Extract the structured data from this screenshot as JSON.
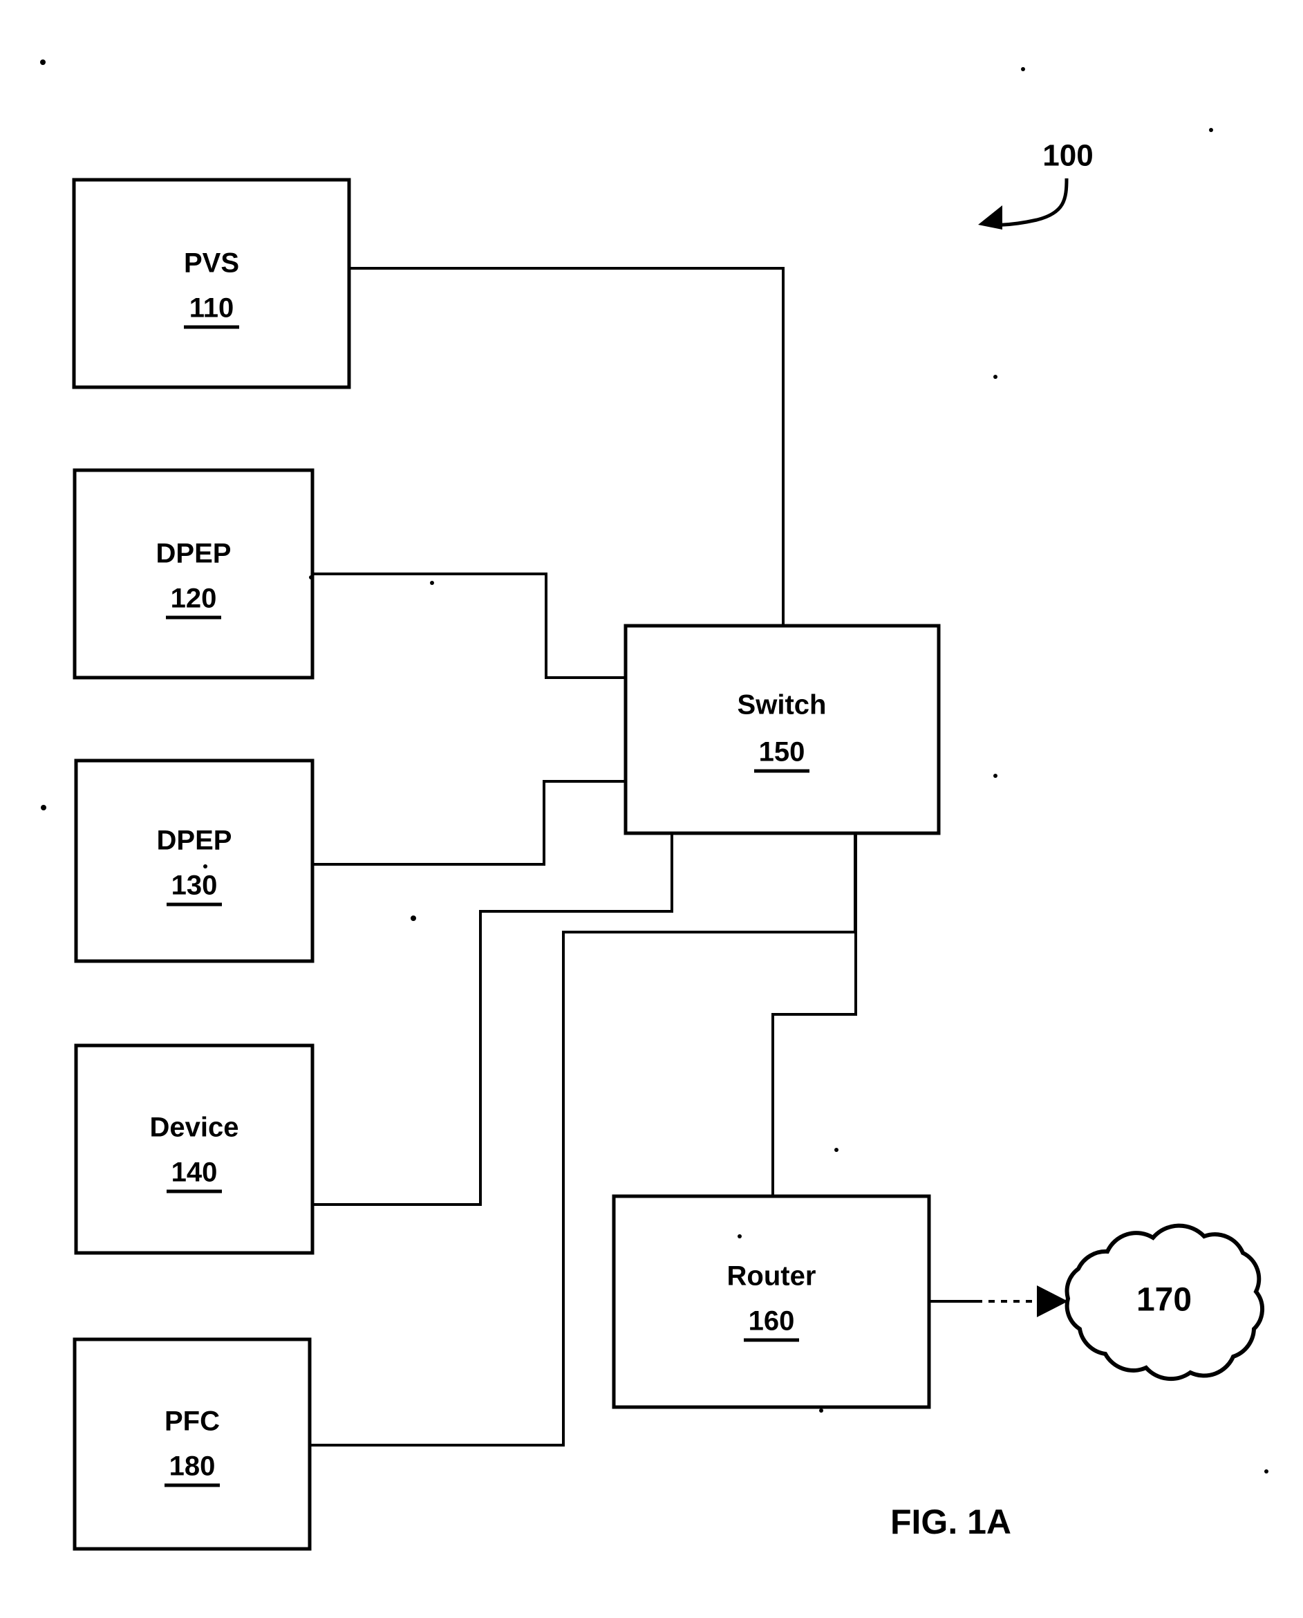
{
  "figure": {
    "caption": "FIG. 1A",
    "system_reference": "100"
  },
  "nodes": [
    {
      "id": "pvs",
      "title": "PVS",
      "ref": "110"
    },
    {
      "id": "dpep1",
      "title": "DPEP",
      "ref": "120"
    },
    {
      "id": "dpep2",
      "title": "DPEP",
      "ref": "130"
    },
    {
      "id": "device",
      "title": "Device",
      "ref": "140"
    },
    {
      "id": "pfc",
      "title": "PFC",
      "ref": "180"
    },
    {
      "id": "switch",
      "title": "Switch",
      "ref": "150"
    },
    {
      "id": "router",
      "title": "Router",
      "ref": "160"
    }
  ],
  "cloud": {
    "ref": "170"
  },
  "connections": [
    {
      "from": "pvs",
      "to": "switch",
      "style": "solid"
    },
    {
      "from": "dpep1",
      "to": "switch",
      "style": "solid"
    },
    {
      "from": "dpep2",
      "to": "switch",
      "style": "solid"
    },
    {
      "from": "device",
      "to": "switch",
      "style": "solid"
    },
    {
      "from": "pfc",
      "to": "switch",
      "style": "solid"
    },
    {
      "from": "switch",
      "to": "router",
      "style": "solid"
    },
    {
      "from": "router",
      "to": "cloud",
      "style": "arrow"
    }
  ],
  "colors": {
    "ink": "#000000",
    "paper": "#ffffff"
  }
}
